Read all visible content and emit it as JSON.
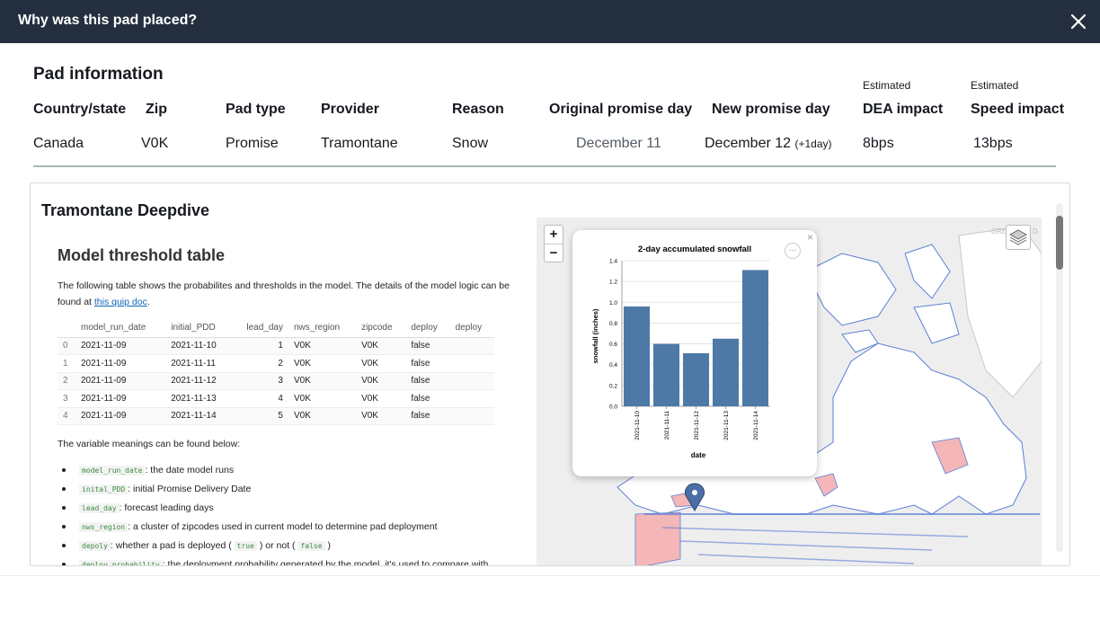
{
  "modal": {
    "title": "Why was this pad placed?"
  },
  "pad_info": {
    "title": "Pad information",
    "estimated_label_1": "Estimated",
    "estimated_label_2": "Estimated",
    "headers": [
      "Country/state",
      "Zip",
      "Pad type",
      "Provider",
      "Reason",
      "Original promise day",
      "New promise day",
      "DEA impact",
      "Speed impact"
    ],
    "values": {
      "country": "Canada",
      "zip": "V0K",
      "pad_type": "Promise",
      "provider": "Tramontane",
      "reason": "Snow",
      "original_day": "December 11",
      "new_day": "December 12",
      "new_day_delta": "(+1day)",
      "dea_impact": "8bps",
      "speed_impact": "13bps"
    }
  },
  "deepdive": {
    "title": "Tramontane Deepdive",
    "doc_heading": "Model threshold table",
    "intro": "The following table shows the probabilites and thresholds in the model. The details of the model logic can be found at ",
    "link_text": "this quip doc",
    "intro_end": ".",
    "table_headers": [
      "",
      "model_run_date",
      "initial_PDD",
      "lead_day",
      "nws_region",
      "zipcode",
      "deploy",
      "deploy"
    ],
    "table_rows": [
      [
        "0",
        "2021-11-09",
        "2021-11-10",
        "1",
        "V0K",
        "V0K",
        "false",
        ""
      ],
      [
        "1",
        "2021-11-09",
        "2021-11-11",
        "2",
        "V0K",
        "V0K",
        "false",
        ""
      ],
      [
        "2",
        "2021-11-09",
        "2021-11-12",
        "3",
        "V0K",
        "V0K",
        "false",
        ""
      ],
      [
        "3",
        "2021-11-09",
        "2021-11-13",
        "4",
        "V0K",
        "V0K",
        "false",
        ""
      ],
      [
        "4",
        "2021-11-09",
        "2021-11-14",
        "5",
        "V0K",
        "V0K",
        "false",
        ""
      ]
    ],
    "vars_intro": "The variable meanings can be found below:",
    "vars": [
      {
        "code": "model_run_date",
        "text": ": the date model runs"
      },
      {
        "code": "inital_PDD",
        "text": ": initial Promise Delivery Date"
      },
      {
        "code": "lead_day",
        "text": ": forecast leading days"
      },
      {
        "code": "nws_region",
        "text": ": a cluster of zipcodes used in current model to determine pad deployment"
      },
      {
        "code": "depoly",
        "text": ": whether a pad is deployed ( ",
        "code2": "true",
        "text2": " ) or not ( ",
        "code3": "false",
        "text3": " )"
      },
      {
        "code": "deploy_probability",
        "text": ": the deployment probability generated by the model, it's used to compare with"
      }
    ],
    "map": {
      "zoom_in": "+",
      "zoom_out": "−",
      "label_green": "GRE",
      "label_d": "D"
    }
  },
  "chart_data": {
    "type": "bar",
    "title": "2-day accumulated snowfall",
    "xlabel": "date",
    "ylabel": "snowfall (inches)",
    "categories": [
      "2021-11-10",
      "2021-11-11",
      "2021-11-12",
      "2021-11-13",
      "2021-11-14"
    ],
    "values": [
      0.96,
      0.6,
      0.51,
      0.65,
      1.31
    ],
    "ylim": [
      0,
      1.4
    ],
    "yticks": [
      "0.0",
      "0.2",
      "0.4",
      "0.6",
      "0.8",
      "1.0",
      "1.2",
      "1.4"
    ],
    "bar_color": "#4e79a7"
  }
}
